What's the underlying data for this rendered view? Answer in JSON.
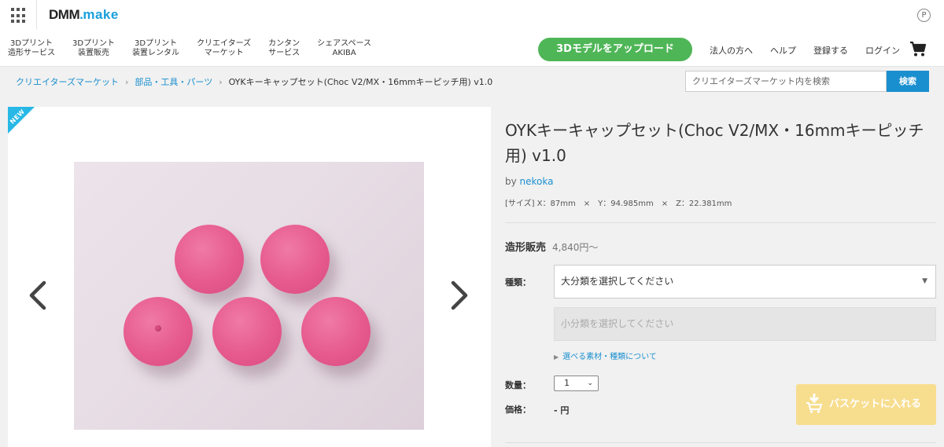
{
  "header": {
    "logo_main": "DMM",
    "logo_dot": ".",
    "logo_sub": "make",
    "point_icon": "P",
    "nav": [
      {
        "label": "3Dプリント\n造形サービス"
      },
      {
        "label": "3Dプリント\n装置販売"
      },
      {
        "label": "3Dプリント\n装置レンタル"
      },
      {
        "label": "クリエイターズ\nマーケット"
      },
      {
        "label": "カンタン\nサービス"
      },
      {
        "label": "シェアスペース\nAKIBA"
      }
    ],
    "upload_label": "3Dモデルをアップロード",
    "utility": [
      "法人の方へ",
      "ヘルプ",
      "登録する",
      "ログイン"
    ],
    "icons": {
      "grid": "app-grid-icon",
      "cart": "cart-icon",
      "point": "point-icon"
    }
  },
  "breadcrumb": {
    "items": [
      "クリエイターズマーケット",
      "部品・工具・パーツ"
    ],
    "separator": "›",
    "current": "OYKキーキャップセット(Choc V2/MX・16mmキーピッチ用) v1.0"
  },
  "search": {
    "placeholder": "クリエイターズマーケット内を検索",
    "button": "検索"
  },
  "gallery": {
    "badge": "NEW",
    "prev_icon": "chevron-left-icon",
    "next_icon": "chevron-right-icon"
  },
  "product": {
    "title": "OYKキーキャップセット(Choc V2/MX・16mmキーピッチ用) v1.0",
    "by_prefix": "by ",
    "author": "nekoka",
    "size": "[サイズ] X：87mm　×　Y：94.985mm　×　Z：22.381mm",
    "sales_label": "造形販売",
    "price_from": "4,840円〜",
    "type_label": "種類：",
    "type_select": "大分類を選択してください",
    "sub_select": "小分類を選択してください",
    "materials_link": "選べる素材・種類について",
    "qty_label": "数量：",
    "qty_value": "1",
    "price_label": "価格：",
    "price_value": "- 円",
    "basket_button": "バスケットに入れる"
  },
  "colors": {
    "accent_blue": "#1a8fcf",
    "upload_green": "#4fb657",
    "basket_yellow": "#f7dd8e",
    "keycap_pink": "#e65a8e",
    "ribbon": "#27b8e6"
  }
}
